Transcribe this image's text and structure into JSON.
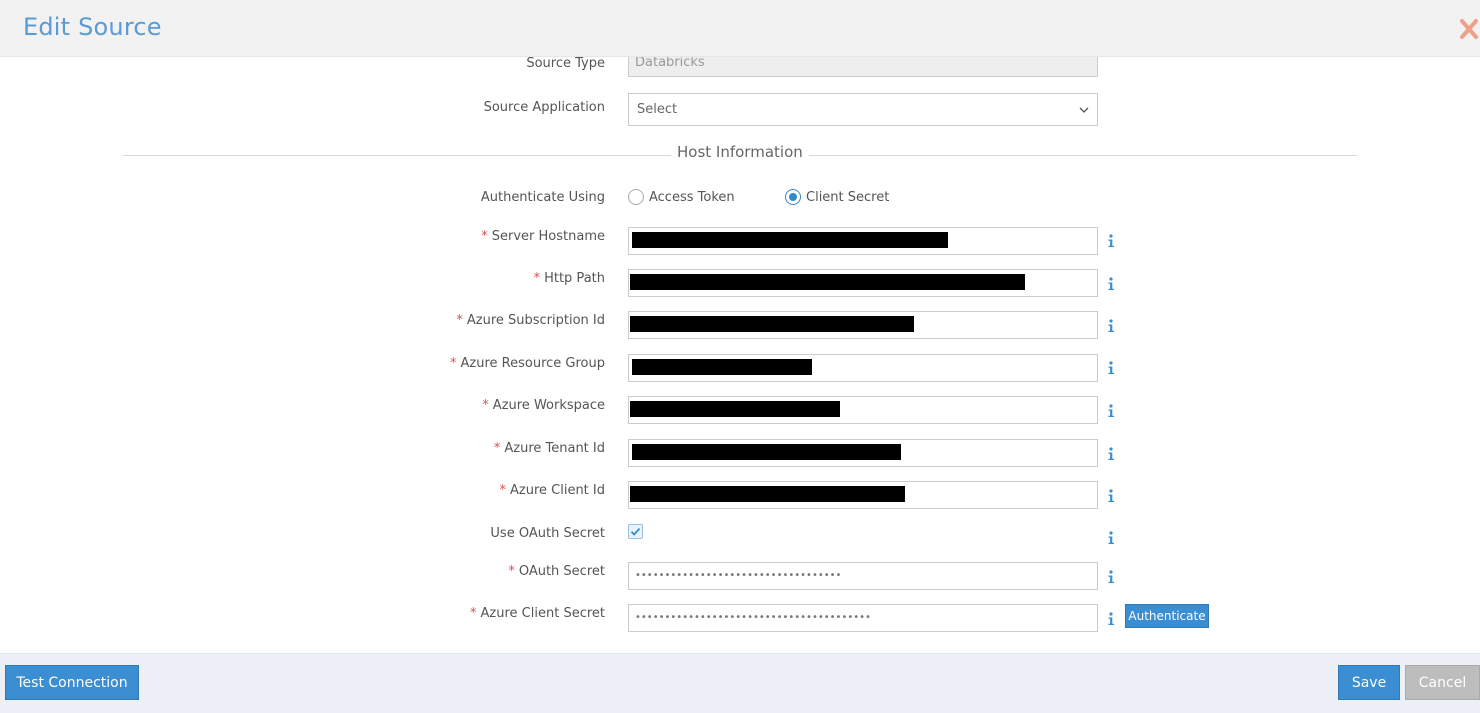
{
  "header": {
    "title": "Edit Source"
  },
  "fields": {
    "source_type": {
      "label": "Source Type",
      "value": "Databricks"
    },
    "source_application": {
      "label": "Source Application",
      "value": "Select"
    },
    "section_title": "Host Information",
    "authenticate_using": {
      "label": "Authenticate Using",
      "options": [
        "Access Token",
        "Client Secret"
      ],
      "selected": "Client Secret"
    },
    "server_hostname": {
      "label": "Server Hostname"
    },
    "http_path": {
      "label": "Http Path"
    },
    "azure_subscription_id": {
      "label": "Azure Subscription Id"
    },
    "azure_resource_group": {
      "label": "Azure Resource Group"
    },
    "azure_workspace": {
      "label": "Azure Workspace"
    },
    "azure_tenant_id": {
      "label": "Azure Tenant Id"
    },
    "azure_client_id": {
      "label": "Azure Client Id"
    },
    "use_oauth_secret": {
      "label": "Use OAuth Secret",
      "checked": true
    },
    "oauth_secret": {
      "label": "OAuth Secret",
      "value": "•••••••••••••••••••••••••••••••••••"
    },
    "azure_client_secret": {
      "label": "Azure Client Secret",
      "value": "••••••••••••••••••••••••••••••••••••••••"
    },
    "required_mark": "*"
  },
  "buttons": {
    "authenticate": "Authenticate",
    "test_connection": "Test Connection",
    "save": "Save",
    "cancel": "Cancel"
  },
  "icons": {
    "close": "close-x-icon",
    "info": "info-icon",
    "checkbox_check": "checkmark-icon",
    "select_chevron": "chevron-down-icon"
  },
  "colors": {
    "title": "#5b9bd5",
    "primary_button": "#3a8ed1",
    "cancel_button": "#bdbdbd",
    "close_icon": "#f0a08a",
    "required": "#d9534f",
    "info_icon": "#3a8ed1"
  }
}
